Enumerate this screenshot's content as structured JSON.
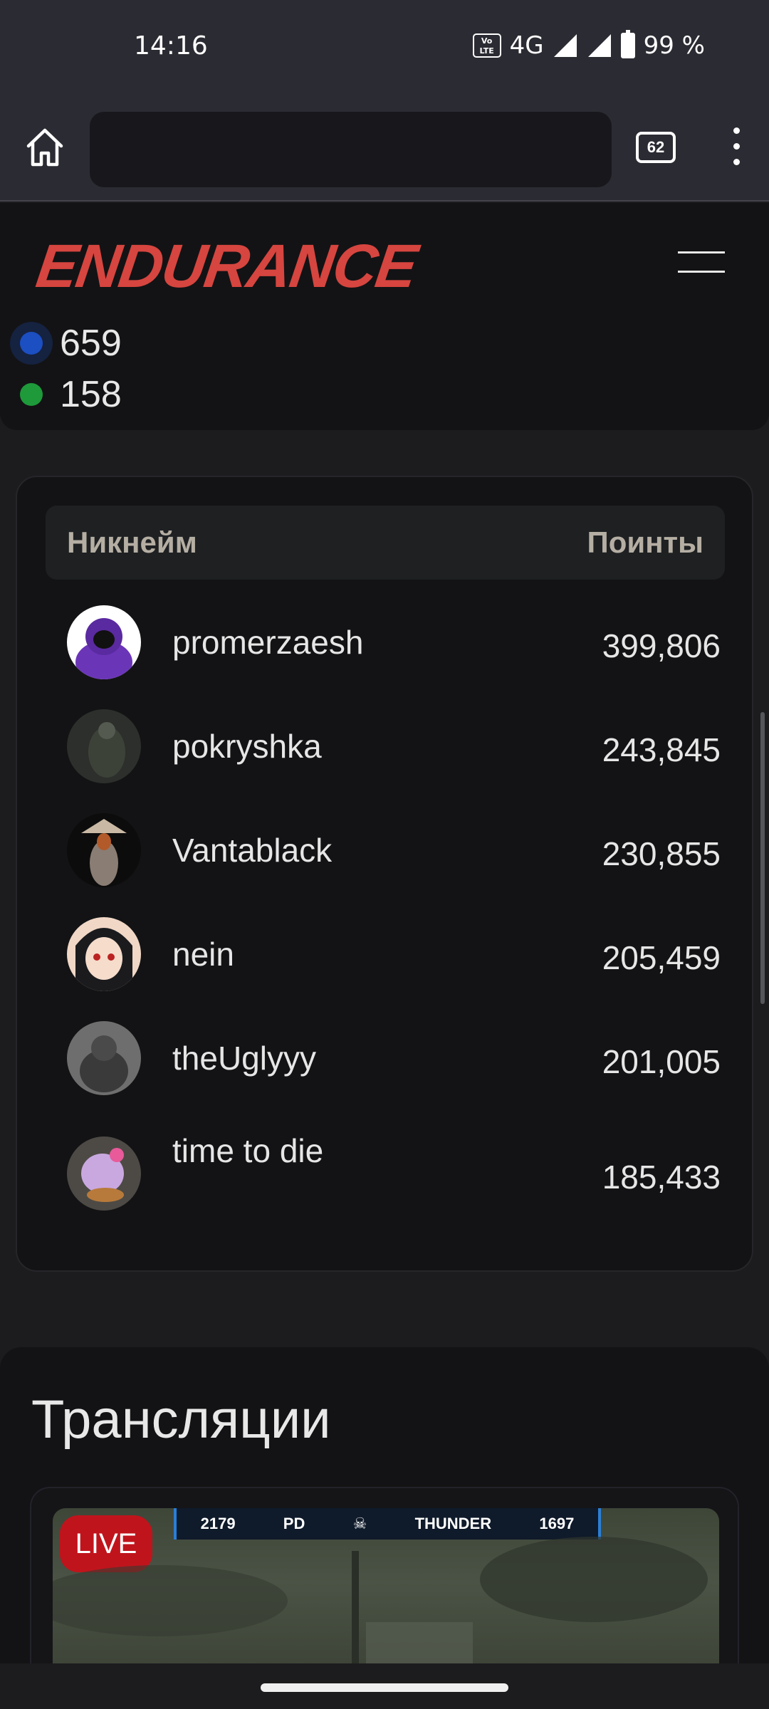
{
  "status_bar": {
    "time": "14:16",
    "volte_label": "Vo LTE",
    "network": "4G",
    "battery": "99 %"
  },
  "browser": {
    "url": "",
    "tab_count": "62",
    "icons": [
      "home-icon",
      "more-vertical-icon"
    ]
  },
  "site": {
    "logo": "ENDURANCE",
    "menu_icon": "hamburger-icon"
  },
  "stats": {
    "items": [
      {
        "value": "659",
        "color": "#1b4fc2"
      },
      {
        "value": "158",
        "color": "#1e9a3a"
      }
    ]
  },
  "leaderboard": {
    "col_nick": "Никнейм",
    "col_points": "Поинты",
    "rows": [
      {
        "nick": "promerzaesh",
        "points": "399,806"
      },
      {
        "nick": "pokryshka",
        "points": "243,845"
      },
      {
        "nick": "Vantablack",
        "points": "230,855"
      },
      {
        "nick": "nein",
        "points": "205,459"
      },
      {
        "nick": "theUglyyy",
        "points": "201,005"
      },
      {
        "nick": "time to die",
        "points": "185,433"
      }
    ]
  },
  "streams": {
    "title": "Трансляции",
    "live_label": "LIVE",
    "hud_left": "2179",
    "hud_tag": "PD",
    "hud_team": "THUNDER",
    "hud_right": "1697"
  },
  "colors": {
    "accent": "#d6453f",
    "live": "#c0141c"
  }
}
